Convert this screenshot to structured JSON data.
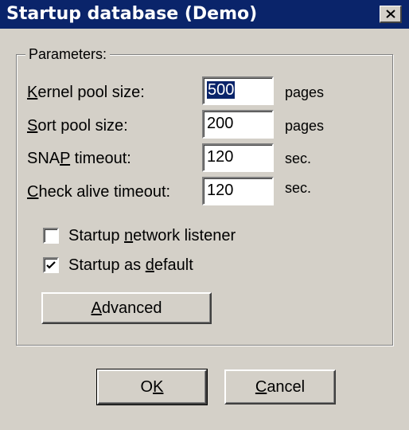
{
  "window": {
    "title": "Startup database (Demo)"
  },
  "group": {
    "title": "Parameters:"
  },
  "kernel_pool": {
    "label_pre": "",
    "label_key": "K",
    "label_post": "ernel pool size:",
    "value": "500",
    "unit": "pages"
  },
  "sort_pool": {
    "label_pre": "",
    "label_key": "S",
    "label_post": "ort pool size:",
    "value": "200",
    "unit": "pages"
  },
  "snap_timeout": {
    "label_pre": "SNA",
    "label_key": "P",
    "label_post": " timeout:",
    "value": "120",
    "unit": "sec."
  },
  "check_alive": {
    "label_pre": "",
    "label_key": "C",
    "label_post": "heck alive timeout:",
    "value": "120",
    "unit": "sec."
  },
  "network_listener": {
    "label_pre": "Startup ",
    "label_key": "n",
    "label_post": "etwork listener",
    "checked": false
  },
  "as_default": {
    "label_pre": "Startup as ",
    "label_key": "d",
    "label_post": "efault",
    "checked": true
  },
  "advanced_button": {
    "label_pre": "",
    "label_key": "A",
    "label_post": "dvanced"
  },
  "ok_button": {
    "label_pre": "O",
    "label_key": "K",
    "label_post": ""
  },
  "cancel_button": {
    "label_pre": "",
    "label_key": "C",
    "label_post": "ancel"
  }
}
